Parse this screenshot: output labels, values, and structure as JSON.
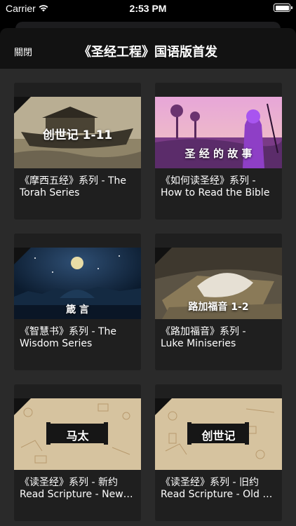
{
  "status": {
    "carrier": "Carrier",
    "time": "2:53 PM"
  },
  "nav": {
    "close_label": "關閉",
    "title": "《圣经工程》国语版首发"
  },
  "cards": [
    {
      "thumb_label": "创世记 1-11",
      "title_line1": "《摩西五经》系列 - The",
      "title_line2": "Torah Series"
    },
    {
      "thumb_label": "圣 经 的 故 事",
      "title_line1": "《如何读圣经》系列 -",
      "title_line2": "How to Read the Bible"
    },
    {
      "thumb_label": "箴 言",
      "title_line1": "《智慧书》系列 - The",
      "title_line2": "Wisdom Series"
    },
    {
      "thumb_label": "路加福音 1-2",
      "title_line1": "《路加福音》系列 -",
      "title_line2": "Luke Miniseries"
    },
    {
      "thumb_label": "马太",
      "title_line1": "《读圣经》系列 - 新约",
      "title_line2": "Read Scripture - New Testament"
    },
    {
      "thumb_label": "创世记",
      "title_line1": "《读圣经》系列 - 旧约",
      "title_line2": "Read Scripture - Old Testament"
    }
  ]
}
